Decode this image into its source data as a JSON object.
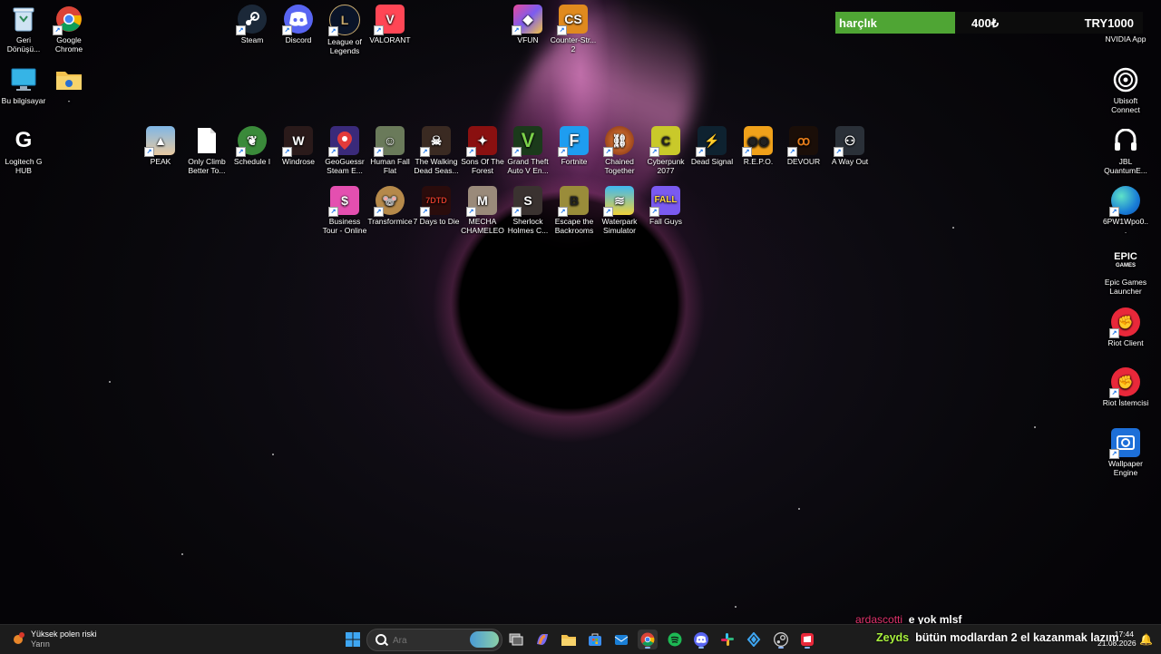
{
  "desktop": {
    "icons_left": [
      {
        "label": "Geri Dönüşü...",
        "icon": "recycle-bin-icon"
      },
      {
        "label": "Google Chrome",
        "icon": "chrome-icon"
      },
      {
        "label": "Bu bilgisayar",
        "icon": "computer-icon"
      },
      {
        "label": "-",
        "icon": "folder-icon"
      },
      {
        "label": "Logitech G HUB",
        "icon": "logitech-icon"
      }
    ],
    "icons_top": [
      {
        "label": "Steam",
        "icon": "steam-icon"
      },
      {
        "label": "Discord",
        "icon": "discord-icon"
      },
      {
        "label": "League of Legends",
        "icon": "league-icon"
      },
      {
        "label": "VALORANT",
        "icon": "valorant-icon"
      },
      {
        "label": "VFUN",
        "icon": "vfun-icon"
      },
      {
        "label": "Counter-Str... 2",
        "icon": "counter-strike-icon"
      }
    ],
    "icons_row1": [
      {
        "label": "PEAK",
        "icon": "peak-icon"
      },
      {
        "label": "Only Climb Better To...",
        "icon": "file-icon"
      },
      {
        "label": "Schedule I",
        "icon": "schedule-icon"
      },
      {
        "label": "Windrose",
        "icon": "windrose-icon"
      },
      {
        "label": "GeoGuessr Steam E...",
        "icon": "geoguessr-icon"
      },
      {
        "label": "Human Fall Flat",
        "icon": "human-fall-flat-icon"
      },
      {
        "label": "The Walking Dead Seas...",
        "icon": "walking-dead-icon"
      },
      {
        "label": "Sons Of The Forest",
        "icon": "sons-forest-icon"
      },
      {
        "label": "Grand Theft Auto V En...",
        "icon": "gta-icon"
      },
      {
        "label": "Fortnite",
        "icon": "fortnite-icon"
      },
      {
        "label": "Chained Together",
        "icon": "chained-together-icon"
      },
      {
        "label": "Cyberpunk 2077",
        "icon": "cyberpunk-icon"
      },
      {
        "label": "Dead Signal",
        "icon": "dead-signal-icon"
      },
      {
        "label": "R.E.P.O.",
        "icon": "repo-icon"
      },
      {
        "label": "DEVOUR",
        "icon": "devour-icon"
      },
      {
        "label": "A Way Out",
        "icon": "a-way-out-icon"
      }
    ],
    "icons_row2": [
      {
        "label": "Business Tour - Online M...",
        "icon": "business-tour-icon"
      },
      {
        "label": "Transformice",
        "icon": "transformice-icon"
      },
      {
        "label": "7 Days to Die",
        "icon": "seven-days-icon"
      },
      {
        "label": "MECHA CHAMELEON",
        "icon": "mecha-chameleon-icon"
      },
      {
        "label": "Sherlock Holmes C...",
        "icon": "sherlock-icon"
      },
      {
        "label": "Escape the Backrooms",
        "icon": "backrooms-icon"
      },
      {
        "label": "Waterpark Simulator",
        "icon": "waterpark-icon"
      },
      {
        "label": "Fall Guys",
        "icon": "fall-guys-icon"
      }
    ],
    "icons_right": [
      {
        "label": "NVIDIA App",
        "icon": "nvidia-icon"
      },
      {
        "label": "Ubisoft Connect",
        "icon": "ubisoft-icon"
      },
      {
        "label": "JBL QuantumE...",
        "icon": "jbl-icon"
      },
      {
        "label": "6PW1Wpo0...",
        "icon": "edge-icon"
      },
      {
        "label": "Epic Games Launcher",
        "icon": "epic-games-icon"
      },
      {
        "label": "Riot Client",
        "icon": "riot-client-icon"
      },
      {
        "label": "Riot İstemcisi",
        "icon": "riot-istemcisi-icon"
      },
      {
        "label": "Wallpaper Engine",
        "icon": "wallpaper-engine-icon"
      }
    ]
  },
  "widget": {
    "name": "harçlık",
    "current": "400₺",
    "goal": "TRY1000",
    "progress_fraction": 0.39,
    "fill_color": "#4fa534"
  },
  "chat": {
    "line1_user": "ardascotti",
    "line1_text": "e yok mlsf",
    "line2_user": "Zeyds",
    "line2_text": "bütün modlardan 2 el kazanmak lazım"
  },
  "taskbar": {
    "weather_title": "Yüksek polen riski",
    "weather_sub": "Yarın",
    "search_placeholder": "Ara",
    "clock_time": "17:44",
    "clock_date": "21.08.2026",
    "apps": [
      "windows-start-icon",
      "task-view-icon",
      "copilot-icon",
      "file-explorer-icon",
      "store-icon",
      "mail-icon",
      "chrome-icon",
      "spotify-icon",
      "discord-icon",
      "slack-icon",
      "app-icon",
      "steam-icon",
      "riot-client-icon"
    ]
  }
}
